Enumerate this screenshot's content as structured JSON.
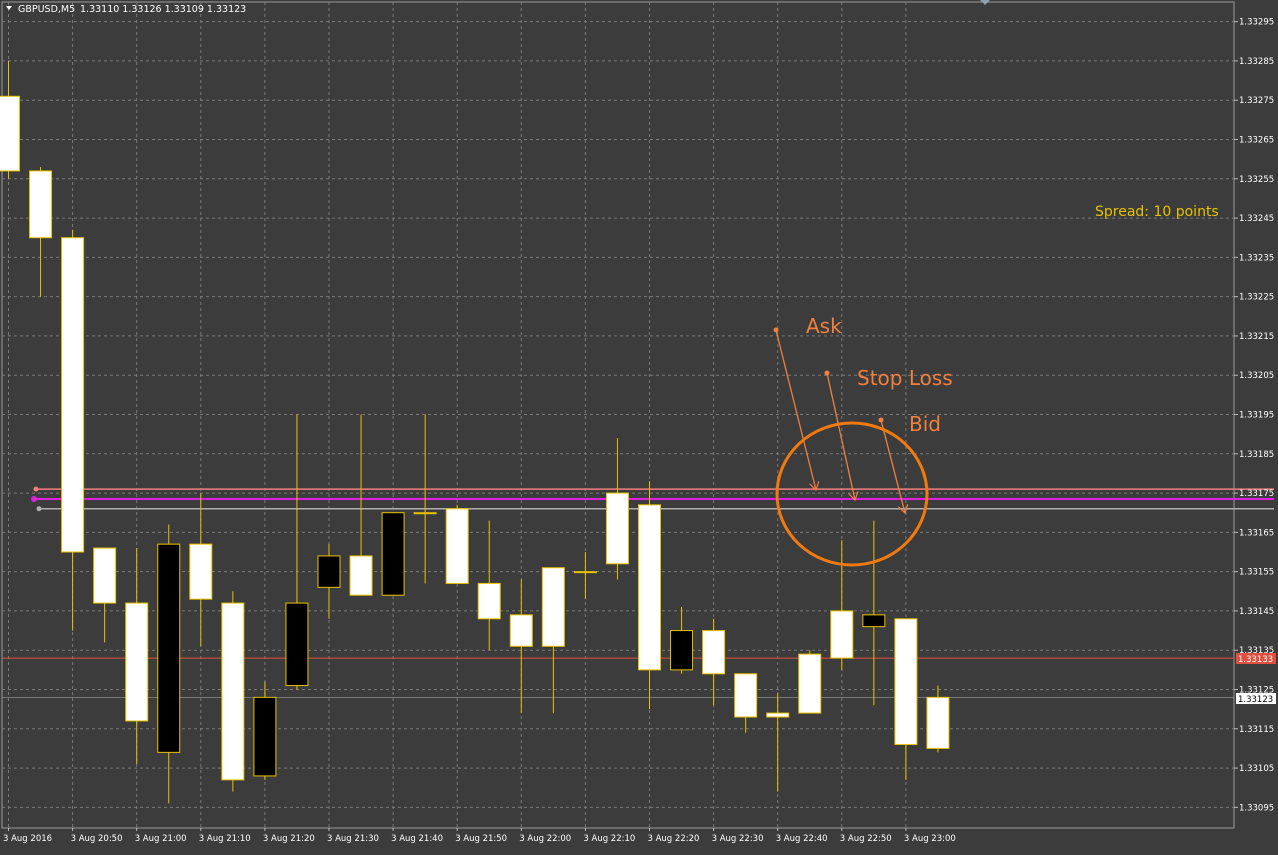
{
  "header": {
    "symbol_label": "GBPUSD,M5",
    "ohlc_label": "1.33110 1.33126 1.33109 1.33123"
  },
  "colors": {
    "background": "#3c3c3c",
    "grid": "#7a7a7a",
    "wick": "#e6c200",
    "bull_fill": "#ffffff",
    "bear_fill": "#000000",
    "ask_line": "#f08080",
    "stop_loss_line": "#e020e0",
    "bid_line": "#b0b0b0",
    "current_price_line": "#e05040",
    "annotation": "#f08040",
    "spread_text": "#e6c200",
    "axis_text": "#ffffff"
  },
  "spread_label": "Spread: 10 points",
  "annotations": [
    {
      "label": "Ask"
    },
    {
      "label": "Stop Loss"
    },
    {
      "label": "Bid"
    }
  ],
  "price_tags": {
    "current": "1.33133",
    "last": "1.33123"
  },
  "chart_data": {
    "type": "candlestick",
    "title": "GBPUSD,M5",
    "ylim": [
      1.3309,
      1.333
    ],
    "y_ticks": [
      "1.33295",
      "1.33285",
      "1.33275",
      "1.33265",
      "1.33255",
      "1.33245",
      "1.33235",
      "1.33225",
      "1.33215",
      "1.33205",
      "1.33195",
      "1.33185",
      "1.33175",
      "1.33165",
      "1.33155",
      "1.33145",
      "1.33135",
      "1.33125",
      "1.33115",
      "1.33105",
      "1.33095"
    ],
    "x_tick_labels": [
      "3 Aug 2016",
      "3 Aug 20:50",
      "3 Aug 21:00",
      "3 Aug 21:10",
      "3 Aug 21:20",
      "3 Aug 21:30",
      "3 Aug 21:40",
      "3 Aug 21:50",
      "3 Aug 22:00",
      "3 Aug 22:10",
      "3 Aug 22:20",
      "3 Aug 22:30",
      "3 Aug 22:40",
      "3 Aug 22:50",
      "3 Aug 23:00"
    ],
    "candles": [
      {
        "o": 1.33257,
        "h": 1.33285,
        "l": 1.33255,
        "c": 1.33276
      },
      {
        "o": 1.3324,
        "h": 1.33258,
        "l": 1.33225,
        "c": 1.33257
      },
      {
        "o": 1.3316,
        "h": 1.33242,
        "l": 1.3314,
        "c": 1.3324
      },
      {
        "o": 1.33147,
        "h": 1.33161,
        "l": 1.33137,
        "c": 1.33161
      },
      {
        "o": 1.33117,
        "h": 1.33161,
        "l": 1.33106,
        "c": 1.33147
      },
      {
        "o": 1.33162,
        "h": 1.33167,
        "l": 1.33096,
        "c": 1.33109
      },
      {
        "o": 1.33148,
        "h": 1.33175,
        "l": 1.33136,
        "c": 1.33162
      },
      {
        "o": 1.33102,
        "h": 1.3315,
        "l": 1.33099,
        "c": 1.33147
      },
      {
        "o": 1.33123,
        "h": 1.33127,
        "l": 1.33102,
        "c": 1.33103
      },
      {
        "o": 1.33147,
        "h": 1.33195,
        "l": 1.33125,
        "c": 1.33126
      },
      {
        "o": 1.33159,
        "h": 1.33162,
        "l": 1.33143,
        "c": 1.33151
      },
      {
        "o": 1.33149,
        "h": 1.33195,
        "l": 1.33149,
        "c": 1.33159
      },
      {
        "o": 1.3317,
        "h": 1.3317,
        "l": 1.33149,
        "c": 1.33149
      },
      {
        "o": 1.3317,
        "h": 1.33195,
        "l": 1.33152,
        "c": 1.3317
      },
      {
        "o": 1.33152,
        "h": 1.33172,
        "l": 1.33152,
        "c": 1.33171
      },
      {
        "o": 1.33143,
        "h": 1.33168,
        "l": 1.33135,
        "c": 1.33152
      },
      {
        "o": 1.33136,
        "h": 1.33153,
        "l": 1.33119,
        "c": 1.33144
      },
      {
        "o": 1.33136,
        "h": 1.33154,
        "l": 1.33119,
        "c": 1.33156
      },
      {
        "o": 1.33155,
        "h": 1.3316,
        "l": 1.33148,
        "c": 1.33155
      },
      {
        "o": 1.33157,
        "h": 1.33189,
        "l": 1.33153,
        "c": 1.33175
      },
      {
        "o": 1.3313,
        "h": 1.33178,
        "l": 1.3312,
        "c": 1.33172
      },
      {
        "o": 1.3314,
        "h": 1.33146,
        "l": 1.33129,
        "c": 1.3313
      },
      {
        "o": 1.33129,
        "h": 1.33143,
        "l": 1.33121,
        "c": 1.3314
      },
      {
        "o": 1.33118,
        "h": 1.33129,
        "l": 1.33114,
        "c": 1.33129
      },
      {
        "o": 1.33118,
        "h": 1.33124,
        "l": 1.33099,
        "c": 1.33119
      },
      {
        "o": 1.33119,
        "h": 1.33135,
        "l": 1.33119,
        "c": 1.33134
      },
      {
        "o": 1.33133,
        "h": 1.33163,
        "l": 1.3313,
        "c": 1.33145
      },
      {
        "o": 1.33144,
        "h": 1.33168,
        "l": 1.33121,
        "c": 1.33141
      },
      {
        "o": 1.33111,
        "h": 1.33143,
        "l": 1.33102,
        "c": 1.33143
      },
      {
        "o": 1.3311,
        "h": 1.33126,
        "l": 1.33109,
        "c": 1.33123
      }
    ],
    "levels": {
      "ask": 1.33176,
      "stop_loss": 1.331735,
      "bid": 1.33171,
      "current": 1.33133
    }
  }
}
